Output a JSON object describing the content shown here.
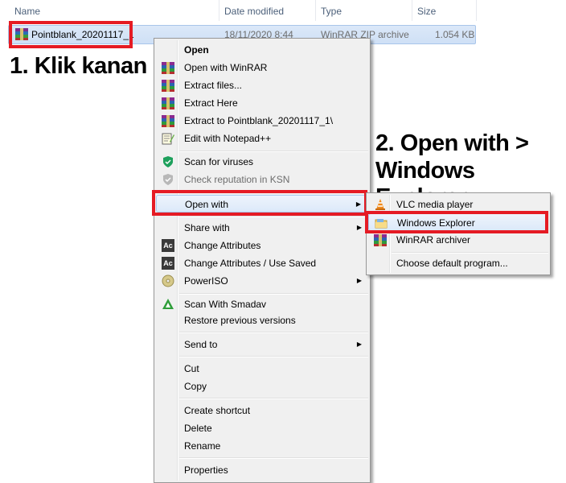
{
  "header": {
    "name": "Name",
    "date_modified": "Date modified",
    "type": "Type",
    "size": "Size"
  },
  "file": {
    "name": "Pointblank_20201117_1",
    "date": "18/11/2020 8:44",
    "type": "WinRAR ZIP archive",
    "size": "1.054 KB"
  },
  "annotations": {
    "step1": "1. Klik kanan",
    "step2_line1": "2. Open with >",
    "step2_line2": "Windows Explorer"
  },
  "colors": {
    "annotation_red": "#e51b24",
    "selection": "#cfe0f6",
    "menu_bg": "#f0f0f0"
  },
  "context_menu": {
    "open": "Open",
    "open_with_winrar": "Open with WinRAR",
    "extract_files": "Extract files...",
    "extract_here": "Extract Here",
    "extract_to": "Extract to Pointblank_20201117_1\\",
    "edit_notepad": "Edit with Notepad++",
    "scan_viruses": "Scan for viruses",
    "check_reputation": "Check reputation in KSN",
    "open_with": "Open with",
    "share_with": "Share with",
    "change_attributes": "Change Attributes",
    "change_attributes_saved": "Change Attributes / Use Saved",
    "poweriso": "PowerISO",
    "scan_smadav": "Scan With Smadav",
    "restore_versions": "Restore previous versions",
    "send_to": "Send to",
    "cut": "Cut",
    "copy": "Copy",
    "create_shortcut": "Create shortcut",
    "delete": "Delete",
    "rename": "Rename",
    "properties": "Properties"
  },
  "submenu": {
    "vlc": "VLC media player",
    "windows_explorer": "Windows Explorer",
    "winrar_archiver": "WinRAR archiver",
    "choose_default": "Choose default program..."
  }
}
